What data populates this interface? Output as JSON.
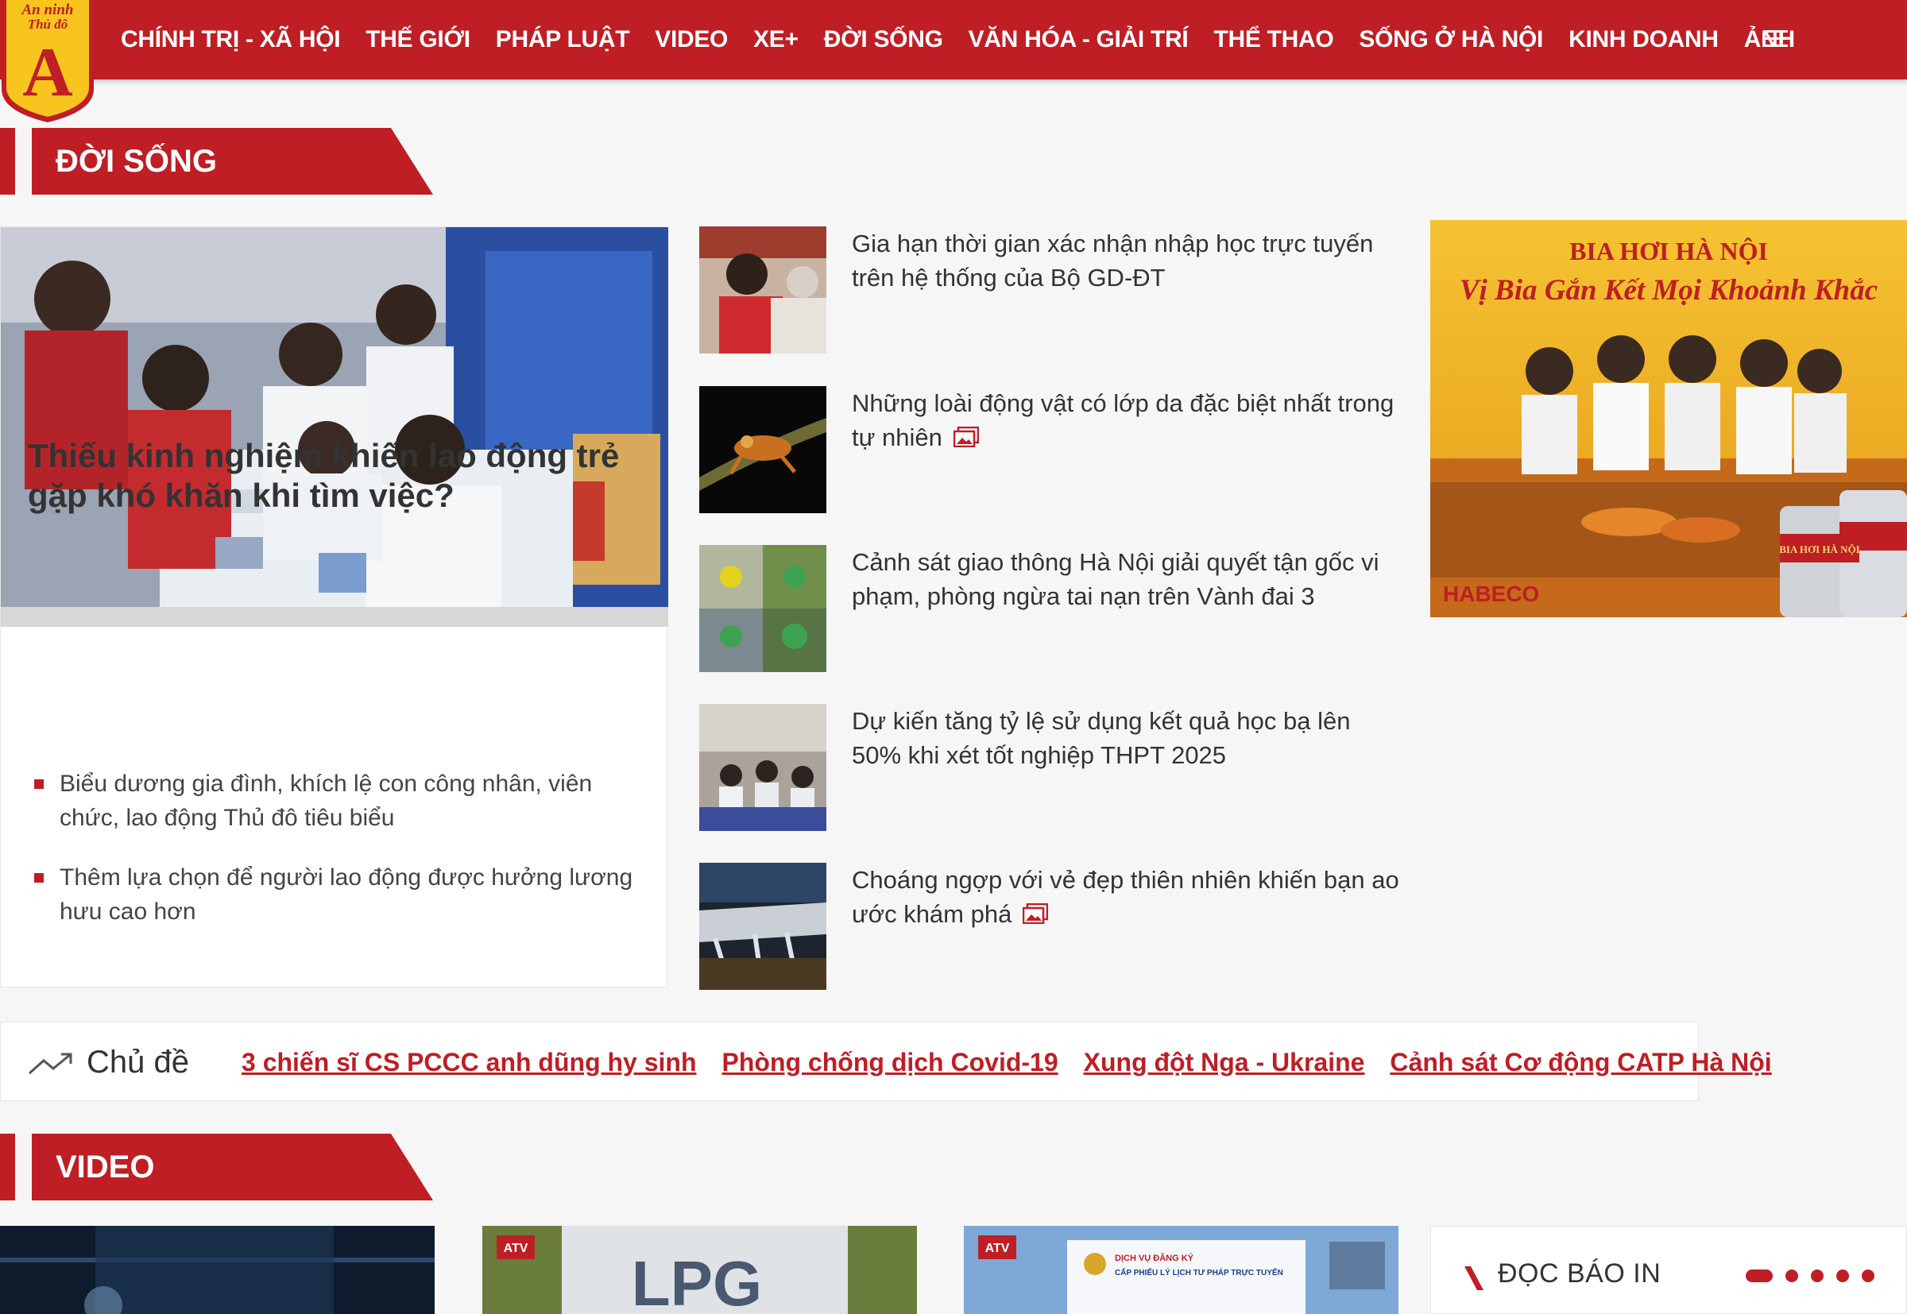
{
  "site": {
    "logo_text_top": "An ninh",
    "logo_text_mid": "Thủ đô",
    "logo_letter": "A",
    "brand_color": "#be1e24"
  },
  "nav": {
    "items": [
      "CHÍNH TRỊ - XÃ HỘI",
      "THẾ GIỚI",
      "PHÁP LUẬT",
      "VIDEO",
      "XE+",
      "ĐỜI SỐNG",
      "VĂN HÓA - GIẢI TRÍ",
      "THỂ THAO",
      "SỐNG Ở HÀ NỘI",
      "KINH DOANH",
      "ẢNH"
    ],
    "menu_icon": "hamburger-icon"
  },
  "section_doi_song": {
    "title": "ĐỜI SỐNG",
    "lead": {
      "title": "Thiếu kinh nghiệm khiến lao động trẻ gặp khó khăn khi tìm việc?",
      "related": [
        "Biểu dương gia đình, khích lệ con công nhân, viên chức, lao động Thủ đô tiêu biểu",
        "Thêm lựa chọn để người lao động được hưởng lương hưu cao hơn"
      ]
    },
    "articles": [
      {
        "title": "Gia hạn thời gian xác nhận nhập học trực tuyến trên hệ thống của Bộ GD-ĐT",
        "photo": false
      },
      {
        "title": "Những loài động vật có lớp da đặc biệt nhất trong tự nhiên",
        "photo": true
      },
      {
        "title": "Cảnh sát giao thông Hà Nội giải quyết tận gốc vi phạm, phòng ngừa tai nạn trên Vành đai 3",
        "photo": false
      },
      {
        "title": "Dự kiến tăng tỷ lệ sử dụng kết quả học bạ lên 50% khi xét tốt nghiệp THPT 2025",
        "photo": false
      },
      {
        "title": "Choáng ngợp với vẻ đẹp thiên nhiên khiến bạn ao ước khám phá",
        "photo": true
      }
    ]
  },
  "ad": {
    "headline": "BIA HƠI HÀ NỘI",
    "tagline": "Vị Bia Gắn Kết Mọi Khoảnh Khắc",
    "brand": "HABECO",
    "keg_label": "BIA HƠI HÀ NỘI"
  },
  "topics": {
    "label": "Chủ đề",
    "links": [
      "3 chiến sĩ CS PCCC anh dũng hy sinh",
      "Phòng chống dịch Covid-19",
      "Xung đột Nga - Ukraine",
      "Cảnh sát Cơ động CATP Hà Nội"
    ]
  },
  "section_video": {
    "title": "VIDEO",
    "thumb2_text": "LPG",
    "thumb3_caption1": "DỊCH VỤ ĐĂNG KÝ",
    "thumb3_caption2": "CẤP PHIẾU LÝ LỊCH TƯ PHÁP TRỰC TUYẾN",
    "atv_label": "ATV"
  },
  "read_print": {
    "title": "ĐỌC BÁO IN",
    "dots": 5,
    "active_dot": 1
  }
}
